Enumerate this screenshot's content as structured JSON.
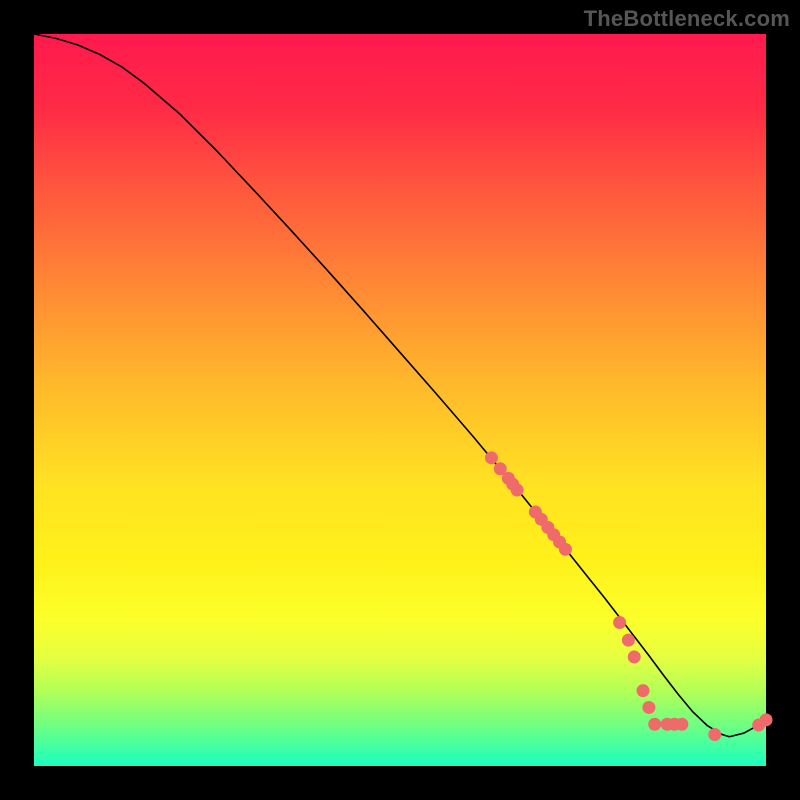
{
  "watermark": "TheBottleneck.com",
  "chart_data": {
    "type": "line",
    "title": "",
    "xlabel": "",
    "ylabel": "",
    "xlim": [
      0,
      100
    ],
    "ylim": [
      0,
      100
    ],
    "grid": false,
    "legend": false,
    "series": [
      {
        "name": "curve",
        "x": [
          0,
          3,
          6,
          9,
          12,
          15,
          20,
          25,
          30,
          35,
          40,
          45,
          50,
          55,
          60,
          63,
          66,
          69,
          72,
          74,
          76,
          78,
          80,
          82,
          84,
          86,
          88,
          90,
          92,
          94,
          95,
          97,
          99,
          100
        ],
        "y": [
          100,
          99.4,
          98.5,
          97.2,
          95.5,
          93.3,
          89.0,
          84.0,
          78.7,
          73.3,
          67.8,
          62.2,
          56.5,
          50.8,
          45.0,
          41.4,
          37.8,
          34.1,
          30.4,
          27.9,
          25.4,
          22.9,
          20.3,
          17.7,
          15.1,
          12.4,
          9.8,
          7.4,
          5.5,
          4.3,
          4.0,
          4.5,
          5.6,
          6.3
        ]
      }
    ],
    "points": {
      "name": "markers",
      "x": [
        62.5,
        63.7,
        64.8,
        65.4,
        66.0,
        68.5,
        69.3,
        70.2,
        71.0,
        71.8,
        72.6,
        80.0,
        81.2,
        82.0,
        83.2,
        84.0,
        84.8,
        86.5,
        87.5,
        88.5,
        93.0,
        99.0,
        100.0
      ],
      "y": [
        42.1,
        40.6,
        39.3,
        38.5,
        37.7,
        34.7,
        33.7,
        32.6,
        31.6,
        30.6,
        29.6,
        19.6,
        17.2,
        14.9,
        10.3,
        8.0,
        5.7,
        5.7,
        5.7,
        5.7,
        4.3,
        5.6,
        6.3
      ]
    }
  }
}
